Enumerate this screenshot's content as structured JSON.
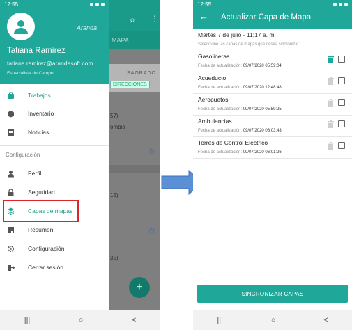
{
  "left_screen": {
    "status_time": "12:55",
    "brand": "Aranda",
    "user": {
      "name": "Tatiana Ramírez",
      "email": "tatiana.ramirez@arandasoft.com",
      "role": "Especialista de Campo"
    },
    "menu_primary": [
      {
        "label": "Trabajos",
        "icon": "briefcase-icon"
      },
      {
        "label": "Inventario",
        "icon": "box-icon"
      },
      {
        "label": "Noticias",
        "icon": "news-icon"
      }
    ],
    "section_label": "Configuración",
    "menu_config": [
      {
        "label": "Perfil",
        "icon": "person-icon"
      },
      {
        "label": "Seguridad",
        "icon": "lock-icon"
      },
      {
        "label": "Capas de mapas",
        "icon": "layers-icon"
      },
      {
        "label": "Resumen",
        "icon": "summary-icon"
      },
      {
        "label": "Configuración",
        "icon": "gear-icon"
      },
      {
        "label": "Cerrar sesión",
        "icon": "logout-icon"
      }
    ],
    "background_app": {
      "tab_label": "MAPA",
      "banner_text": "SAGRADO",
      "directions_label": "DIRECCIONES",
      "row1_a": "57)",
      "row1_b": "ombia",
      "row2": "15)",
      "row3": "35)"
    },
    "colors": {
      "primary": "#1fa899",
      "highlight": "#d8262b"
    }
  },
  "right_screen": {
    "status_time": "12:55",
    "title": "Actualizar Capa de Mapa",
    "date_line": "Martes 7 de julio - 11:17 a. m.",
    "hint": "Seleccione las capas de mapas que desea sincronizar",
    "date_prefix": "Fecha de actualización:",
    "layers": [
      {
        "name": "Gasolineras",
        "updated": "09/07/2020 05:59:04",
        "trash_active": true
      },
      {
        "name": "Acueducto",
        "updated": "09/07/2020 12:48:48",
        "trash_active": false
      },
      {
        "name": "Aeropuetos",
        "updated": "09/07/2020 05:59:25",
        "trash_active": false
      },
      {
        "name": "Ambulancias",
        "updated": "09/07/2020 06:03:43",
        "trash_active": false
      },
      {
        "name": "Torres de Control Eléctrico",
        "updated": "09/07/2020 06:01:26",
        "trash_active": false
      }
    ],
    "sync_button": "SINCRONIZAR CAPAS"
  },
  "nav": {
    "recent": "|||",
    "home": "○",
    "back": "<"
  }
}
